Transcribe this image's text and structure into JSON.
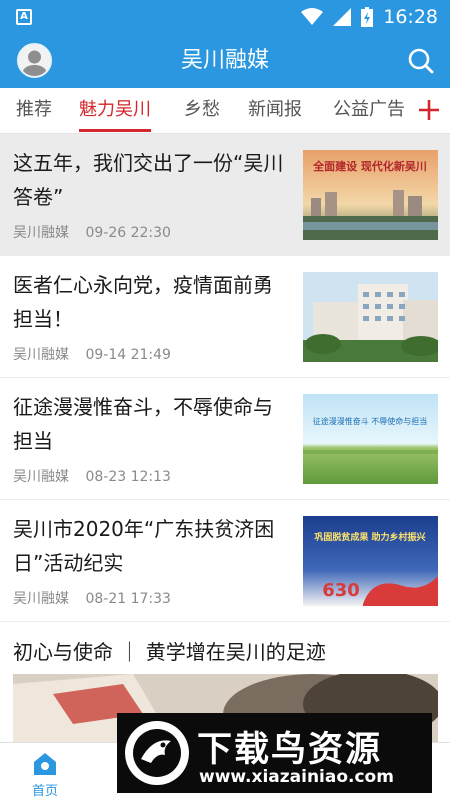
{
  "status_bar": {
    "time": "16:28"
  },
  "header": {
    "title": "吴川融媒"
  },
  "tabs": [
    {
      "label": "推荐"
    },
    {
      "label": "魅力吴川",
      "active": true
    },
    {
      "label": "乡愁"
    },
    {
      "label": "新闻报"
    },
    {
      "label": "公益广告"
    }
  ],
  "news": [
    {
      "title": "这五年，我们交出了一份“吴川答卷”",
      "source": "吴川融媒",
      "time": "09-26 22:30",
      "thumb_caption": "全面建设 现代化新吴川"
    },
    {
      "title": "医者仁心永向党，疫情面前勇担当！",
      "source": "吴川融媒",
      "time": "09-14 21:49"
    },
    {
      "title": "征途漫漫惟奋斗，不辱使命与担当",
      "source": "吴川融媒",
      "time": "08-23 12:13",
      "thumb_caption": "征途漫漫惟奋斗 不辱使命与担当"
    },
    {
      "title": "吴川市2020年“广东扶贫济困日”活动纪实",
      "source": "吴川融媒",
      "time": "08-21 17:33",
      "thumb_caption": "巩固脱贫成果 助力乡村振兴",
      "thumb_badge": "630"
    }
  ],
  "feature": {
    "title": "初心与使命 ｜ 黄学增在吴川的足迹"
  },
  "bottom_nav": {
    "home_label": "首页"
  },
  "watermark": {
    "name": "下载鸟资源",
    "url": "www.xiazainiao.com"
  },
  "colors": {
    "primary": "#2a97e0",
    "accent": "#d4262b"
  }
}
